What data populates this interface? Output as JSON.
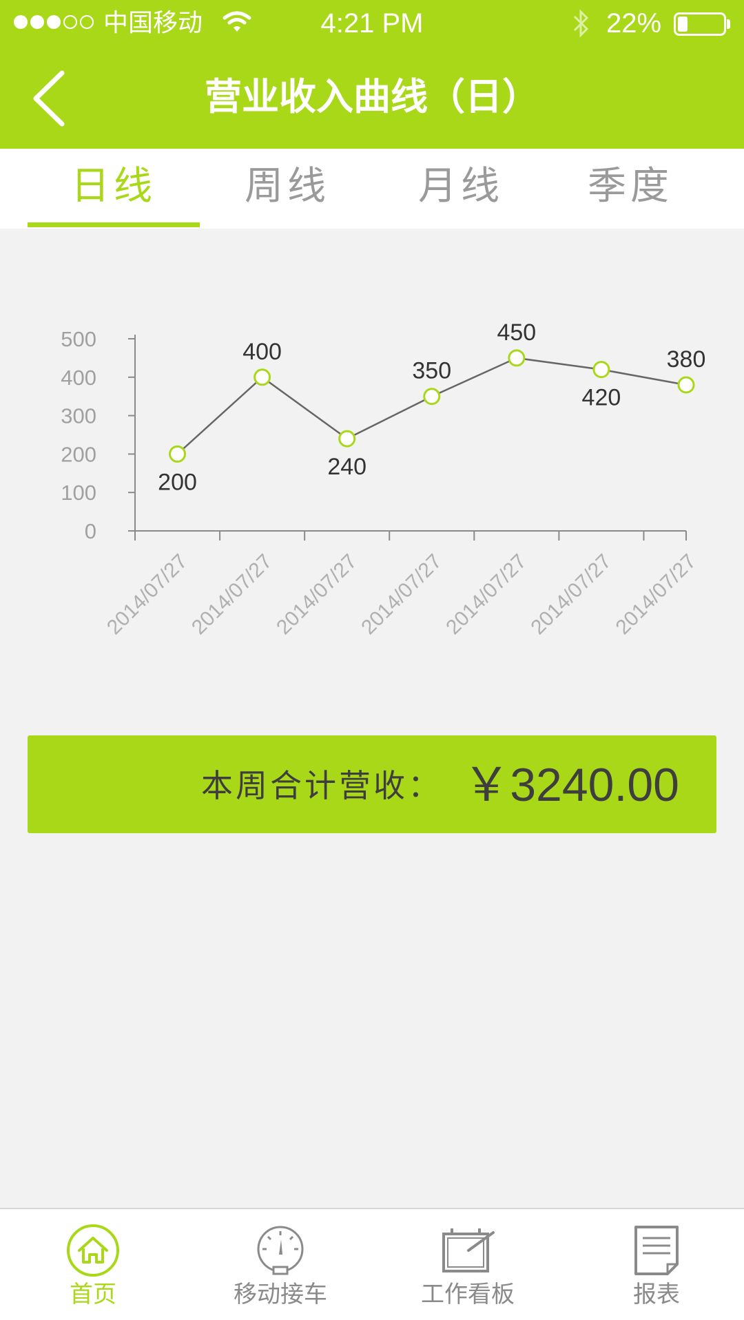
{
  "status_bar": {
    "carrier": "中国移动",
    "time": "4:21 PM",
    "battery": "22%",
    "battery_level": 0.22
  },
  "nav": {
    "title": "营业收入曲线（日）"
  },
  "tabs": [
    {
      "label": "日线",
      "active": true
    },
    {
      "label": "周线",
      "active": false
    },
    {
      "label": "月线",
      "active": false
    },
    {
      "label": "季度",
      "active": false
    }
  ],
  "chart_data": {
    "type": "line",
    "categories": [
      "2014/07/27",
      "2014/07/27",
      "2014/07/27",
      "2014/07/27",
      "2014/07/27",
      "2014/07/27",
      "2014/07/27"
    ],
    "series": [
      {
        "values": [
          200,
          400,
          240,
          350,
          450,
          420,
          380
        ]
      }
    ],
    "y_ticks": [
      0,
      100,
      200,
      300,
      400,
      500
    ],
    "ylim": [
      0,
      500
    ],
    "grid": false,
    "line_color": "#666666",
    "marker_color": "#a9d819"
  },
  "summary": {
    "label": "本周合计营收：",
    "value": "￥3240.00"
  },
  "tab_bar": [
    {
      "label": "首页",
      "icon": "home-icon",
      "active": true
    },
    {
      "label": "移动接车",
      "icon": "gauge-icon",
      "active": false
    },
    {
      "label": "工作看板",
      "icon": "board-icon",
      "active": false
    },
    {
      "label": "报表",
      "icon": "report-icon",
      "active": false
    }
  ],
  "colors": {
    "accent": "#a9d819",
    "background": "#f2f2f2",
    "text_dark": "#3e3e3e",
    "text_muted": "#9a9a9a"
  }
}
